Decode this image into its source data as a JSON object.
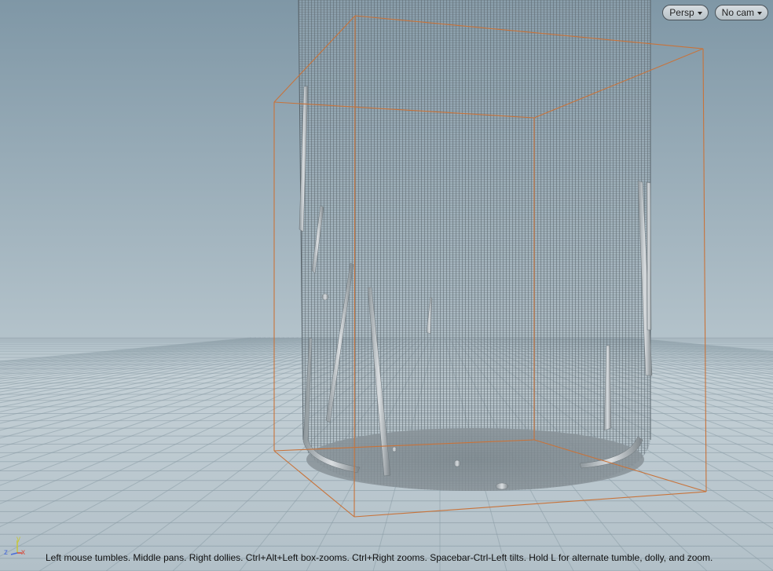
{
  "toolbar": {
    "projection_label": "Persp",
    "camera_label": "No cam"
  },
  "status": {
    "hint": "Left mouse tumbles. Middle pans. Right dollies. Ctrl+Alt+Left box-zooms. Ctrl+Right zooms. Spacebar-Ctrl-Left tilts. Hold L for alternate tumble, dolly, and zoom."
  },
  "axis": {
    "y_label": "y",
    "z_label": "z",
    "x_label": "x"
  },
  "colors": {
    "background_top": "#7f97a6",
    "background_horizon": "#c4d0d6",
    "ground": "#b5c3cb",
    "grid_line": "#8b9ca6",
    "bbox_outline": "#c8733a",
    "mesh_line": "#59646b",
    "axis_x": "#d84a3a",
    "axis_y": "#c6c63a",
    "axis_z": "#4a6cd8"
  }
}
